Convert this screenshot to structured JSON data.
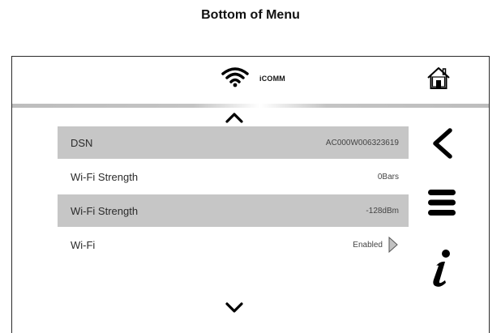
{
  "page": {
    "caption": "Bottom of Menu"
  },
  "header": {
    "brand": "iCOMM",
    "icons": {
      "wifi": "wifi-icon",
      "home": "home-icon"
    }
  },
  "rows": [
    {
      "label": "DSN",
      "value": "AC000W006323619",
      "shaded": true
    },
    {
      "label": "Wi-Fi Strength",
      "value": "0Bars",
      "shaded": false
    },
    {
      "label": "Wi-Fi Strength",
      "value": "-128dBm",
      "shaded": true
    },
    {
      "label": "Wi-Fi",
      "value": "Enabled",
      "shaded": false,
      "has_arrow": true
    }
  ],
  "sidebar": {
    "icons": [
      "back-icon",
      "menu-icon",
      "info-icon"
    ]
  },
  "colors": {
    "row_shade": "#c6c6c6",
    "divider": "#bdbdbd",
    "arrow_fill": "#c2c2c2",
    "text": "#2b2b2b"
  }
}
